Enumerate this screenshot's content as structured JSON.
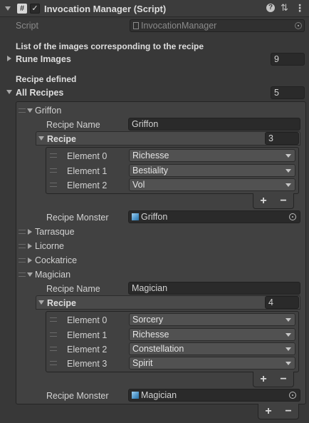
{
  "header": {
    "title": "Invocation Manager (Script)",
    "enabled": true,
    "script_label": "Script",
    "script_value": "InvocationManager",
    "icon_hash": "#",
    "help_icon": "?",
    "settings_icon": "⇅",
    "menu_icon": "⋮"
  },
  "rune_section": {
    "header": "List of the images corresponding to the recipe",
    "label": "Rune Images",
    "count": "9"
  },
  "recipes_section": {
    "header": "Recipe defined",
    "label": "All Recipes",
    "count": "5"
  },
  "recipes": [
    {
      "name": "Griffon",
      "expanded": true,
      "recipe_name_label": "Recipe Name",
      "recipe_name_value": "Griffon",
      "recipe_label": "Recipe",
      "recipe_count": "3",
      "elements": [
        {
          "label": "Element 0",
          "value": "Richesse"
        },
        {
          "label": "Element 1",
          "value": "Bestiality"
        },
        {
          "label": "Element 2",
          "value": "Vol"
        }
      ],
      "monster_label": "Recipe Monster",
      "monster_value": "Griffon"
    },
    {
      "name": "Tarrasque",
      "expanded": false
    },
    {
      "name": "Licorne",
      "expanded": false
    },
    {
      "name": "Cockatrice",
      "expanded": false
    },
    {
      "name": "Magician",
      "expanded": true,
      "recipe_name_label": "Recipe Name",
      "recipe_name_value": "Magician",
      "recipe_label": "Recipe",
      "recipe_count": "4",
      "elements": [
        {
          "label": "Element 0",
          "value": "Sorcery"
        },
        {
          "label": "Element 1",
          "value": "Richesse"
        },
        {
          "label": "Element 2",
          "value": "Constellation"
        },
        {
          "label": "Element 3",
          "value": "Spirit"
        }
      ],
      "monster_label": "Recipe Monster",
      "monster_value": "Magician"
    }
  ],
  "buttons": {
    "plus": "+",
    "minus": "−"
  }
}
